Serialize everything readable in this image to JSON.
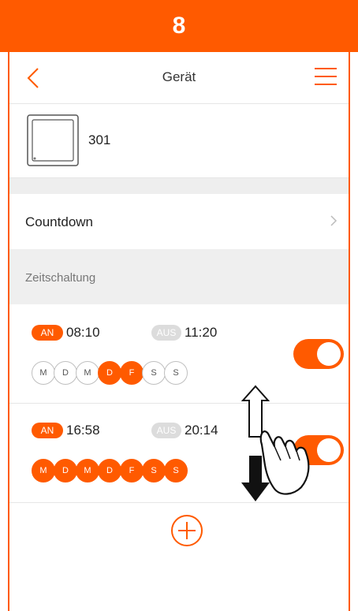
{
  "step": {
    "number": "8"
  },
  "header": {
    "title": "Gerät",
    "back_icon": "chevron-left-icon",
    "menu_icon": "hamburger-menu-icon"
  },
  "device": {
    "name": "301",
    "icon": "wall-switch-icon"
  },
  "countdown": {
    "label": "Countdown",
    "chevron_icon": "chevron-right-icon"
  },
  "section": {
    "label": "Zeitschaltung"
  },
  "schedules": [
    {
      "on_label": "AN",
      "on_time": "08:10",
      "off_label": "AUS",
      "off_time": "11:20",
      "days": [
        {
          "label": "M",
          "active": false
        },
        {
          "label": "D",
          "active": false
        },
        {
          "label": "M",
          "active": false
        },
        {
          "label": "D",
          "active": true
        },
        {
          "label": "F",
          "active": true
        },
        {
          "label": "S",
          "active": false
        },
        {
          "label": "S",
          "active": false
        }
      ],
      "enabled": true
    },
    {
      "on_label": "AN",
      "on_time": "16:58",
      "off_label": "AUS",
      "off_time": "20:14",
      "days": [
        {
          "label": "M",
          "active": true
        },
        {
          "label": "D",
          "active": true
        },
        {
          "label": "M",
          "active": true
        },
        {
          "label": "D",
          "active": true
        },
        {
          "label": "F",
          "active": true
        },
        {
          "label": "S",
          "active": true
        },
        {
          "label": "S",
          "active": true
        }
      ],
      "enabled": true
    }
  ],
  "add_icon": "plus-circle-icon",
  "overlay_icon": "hand-swipe-up-down-icon",
  "colors": {
    "accent": "#ff5a00",
    "divider": "#e6e6e6",
    "section_bg": "#efefef"
  }
}
